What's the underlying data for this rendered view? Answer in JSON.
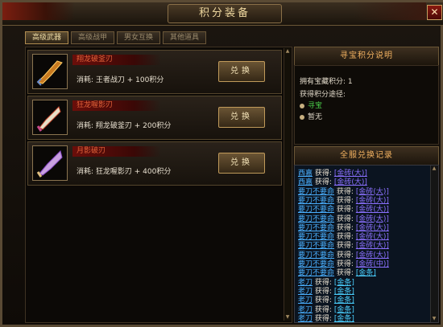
{
  "window": {
    "title": "积分装备",
    "close_label": "✕"
  },
  "tabs": [
    {
      "label": "高级武器",
      "active": true
    },
    {
      "label": "高级战甲",
      "active": false
    },
    {
      "label": "男女互换",
      "active": false
    },
    {
      "label": "其他道具",
      "active": false
    }
  ],
  "items": [
    {
      "name": "翔龙破釜刃",
      "cost": "消耗: 王者战刀 + 100积分",
      "button": "兑换"
    },
    {
      "name": "狂龙喔影刃",
      "cost": "消耗: 翔龙破釜刃 + 200积分",
      "button": "兑换"
    },
    {
      "name": "月影破刃",
      "cost": "消耗: 狂龙喔影刃 + 400积分",
      "button": "兑换"
    }
  ],
  "info": {
    "header": "寻宝积分说明",
    "owned": "拥有宝藏积分: 1",
    "ways_label": "获得积分途径:",
    "ways": [
      "寻宝",
      "暂无"
    ],
    "way_colors": [
      "#4ad04a",
      "#e0d8c8"
    ]
  },
  "log": {
    "header": "全服兑换记录",
    "got": "获得:",
    "rows": [
      {
        "player": "西嘉",
        "item": "[金砖(大)]",
        "gold": false
      },
      {
        "player": "西嘉",
        "item": "[金砖(大)]",
        "gold": false
      },
      {
        "player": "要刀不要命",
        "item": "[金砖(大)]",
        "gold": false
      },
      {
        "player": "要刀不要命",
        "item": "[金砖(大)]",
        "gold": false
      },
      {
        "player": "要刀不要命",
        "item": "[金砖(大)]",
        "gold": false
      },
      {
        "player": "要刀不要命",
        "item": "[金砖(大)]",
        "gold": false
      },
      {
        "player": "要刀不要命",
        "item": "[金砖(大)]",
        "gold": false
      },
      {
        "player": "要刀不要命",
        "item": "[金砖(大)]",
        "gold": false
      },
      {
        "player": "要刀不要命",
        "item": "[金砖(大)]",
        "gold": false
      },
      {
        "player": "要刀不要命",
        "item": "[金砖(大)]",
        "gold": false
      },
      {
        "player": "要刀不要命",
        "item": "[金砖(中)]",
        "gold": false
      },
      {
        "player": "要刀不要命",
        "item": "[金条]",
        "gold": true
      },
      {
        "player": "老刀",
        "item": "[金条]",
        "gold": true
      },
      {
        "player": "老刀",
        "item": "[金条]",
        "gold": true
      },
      {
        "player": "老刀",
        "item": "[金条]",
        "gold": true
      },
      {
        "player": "老刀",
        "item": "[金条]",
        "gold": true
      },
      {
        "player": "老刀",
        "item": "[金条]",
        "gold": true
      }
    ]
  },
  "scrollbars": {
    "up": "▲",
    "down": "▼"
  }
}
